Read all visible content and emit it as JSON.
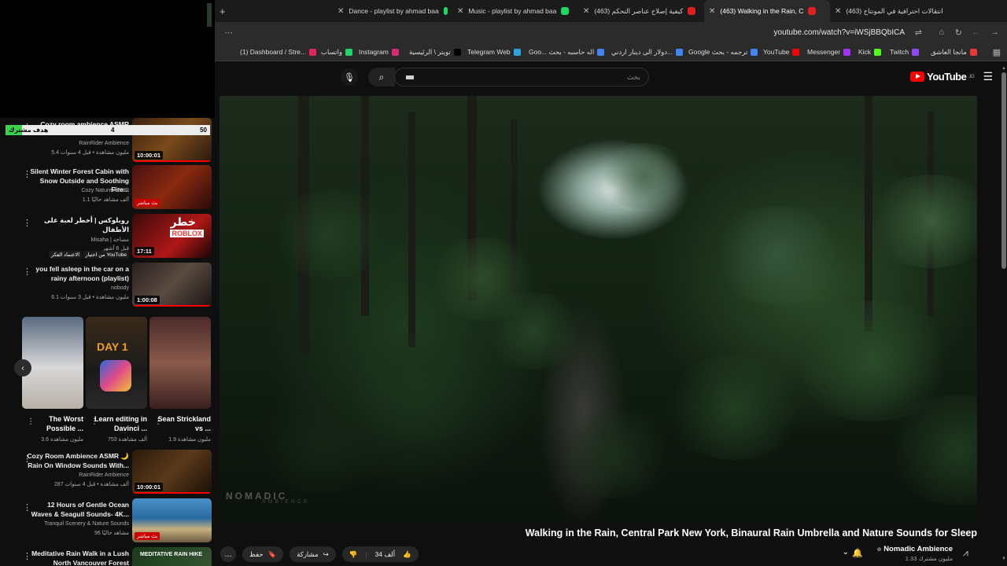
{
  "browser": {
    "tabs": [
      {
        "title": "Dance - playlist by ahmad baa",
        "icon": "spotify",
        "active": false
      },
      {
        "title": "Music - playlist by ahmad baa",
        "icon": "spotify",
        "active": false
      },
      {
        "title": "(463) كيفية إصلاح عناصر التحكم",
        "icon": "youtube",
        "active": false
      },
      {
        "title": "(463) Walking in the Rain, C",
        "icon": "youtube",
        "active": true
      },
      {
        "title": "(463) انتقالات احترافية في المونتاج",
        "icon": "youtube",
        "active": false
      }
    ],
    "new_tab": "+",
    "url": "youtube.com/watch?v=iWSjBBQbICA",
    "bookmarks": [
      {
        "label": "(1) Dashboard / Stre...",
        "color": "#e0245e"
      },
      {
        "label": "واتساب",
        "color": "#25d366"
      },
      {
        "label": "Instagram",
        "color": "#d62976"
      },
      {
        "label": "تويتر \\ الرئيسية",
        "color": "#000000"
      },
      {
        "label": "Telegram Web",
        "color": "#2aa3de"
      },
      {
        "label": "Goo... اله حاسبه - بحث",
        "color": "#4285f4"
      },
      {
        "label": "دولار الى دينار اردني...",
        "color": "#4285f4"
      },
      {
        "label": "Google ترجمه - بحث",
        "color": "#4285f4"
      },
      {
        "label": "YouTube",
        "color": "#ff0000"
      },
      {
        "label": "Messenger",
        "color": "#a033ff"
      },
      {
        "label": "Kick",
        "color": "#53fc18"
      },
      {
        "label": "Twitch",
        "color": "#9146ff"
      },
      {
        "label": "مانجا العاشق",
        "color": "#e53935"
      }
    ]
  },
  "youtube": {
    "logo": "YouTube",
    "logo_sup": "JO",
    "search_placeholder": "بحث"
  },
  "video": {
    "title": "Walking in the Rain, Central Park New York, Binaural Rain Umbrella and Nature Sounds for Sleep",
    "watermark": "NOMADIC",
    "watermark_sub": "AMBIENCE",
    "channel_name": "Nomadic Ambience",
    "channel_subs": "1.33 مليون مشترك",
    "likes": "34 ألف",
    "share": "مشاركة",
    "save": "حفظ",
    "more": "..."
  },
  "goal": {
    "label": "هدف مشترك",
    "current": "4",
    "max": "50",
    "fraction": 0.08
  },
  "recommendations": [
    {
      "title": "Cozy room ambience ASMR",
      "channel": "RainRider Ambience",
      "meta": "5.4 مليون مشاهدة • قبل 4 سنوات",
      "duration": "10:00:01",
      "progress": 1.0,
      "live": ""
    },
    {
      "title": "Silent Winter Forest Cabin with Snow Outside and Soothing Fire...",
      "channel": "Cozy Nature ASMR",
      "meta": "1.1 ألف مشاهد حاليًا",
      "duration": "",
      "progress": 0,
      "live": "بث مباشر"
    },
    {
      "title": "روبلوكس | أخطر لعبة على الأطفال",
      "channel": "Misaha | مساحة",
      "meta": "قبل 6 أشهر",
      "duration": "17:11",
      "progress": 0,
      "live": "",
      "badge": "من اختيار YouTube",
      "badge2": "الاعتماد الفكر"
    },
    {
      "title": "you fell asleep in the car on a rainy afternoon (playlist)",
      "channel": "nobody",
      "meta": "6.1 مليون مشاهدة • قبل 3 سنوات",
      "duration": "1:00:08",
      "progress": 1.0,
      "live": ""
    },
    {
      "title": "Cozy Room Ambience ASMR 🌙 Rain On Window Sounds With...",
      "channel": "RainRider Ambience",
      "meta": "287 ألف مشاهدة • قبل 4 سنوات",
      "duration": "10:00:01",
      "progress": 1.0,
      "live": ""
    },
    {
      "title": "12 Hours of Gentle Ocean Waves & Seagull Sounds- 4K...",
      "channel": "Tranquil Scenery & Nature Sounds",
      "meta": "96 مشاهد حاليًا",
      "duration": "",
      "progress": 0,
      "live": "بث مباشر"
    },
    {
      "title": "Meditative Rain Walk in a Lush North Vancouver Forest",
      "channel": "",
      "meta": "",
      "duration": "",
      "progress": 0,
      "live": "",
      "thumb_text": "MEDITATIVE RAIN HIKE"
    }
  ],
  "shorts": [
    {
      "title": "The Worst Possible ...",
      "views": "3.6 مليون مشاهدة"
    },
    {
      "title": "Learn editing in Davinci ...",
      "views": "753 ألف مشاهدة",
      "thumb_text": "DAY 1"
    },
    {
      "title": "Sean Strickland vs ...",
      "views": "1.9 مليون مشاهدة"
    }
  ],
  "red_thumb_text": "خطر",
  "red_thumb_sub": "ROBLOX"
}
